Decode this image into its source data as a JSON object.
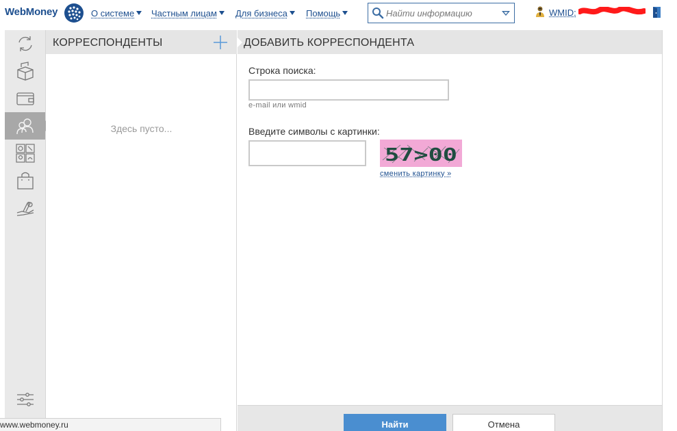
{
  "header": {
    "logo_text": "WebMoney",
    "nav": [
      {
        "label": "О системе"
      },
      {
        "label": "Частным лицам"
      },
      {
        "label": "Для бизнеса"
      },
      {
        "label": "Помощь"
      }
    ],
    "search_placeholder": "Найти информацию",
    "wmid_label": "WMID:"
  },
  "rail": {
    "items": [
      {
        "icon": "refresh-icon"
      },
      {
        "icon": "boxes-icon"
      },
      {
        "icon": "wallet-icon"
      },
      {
        "icon": "correspondents-icon",
        "active": true
      },
      {
        "icon": "services-icon"
      },
      {
        "icon": "shopping-bag-icon"
      },
      {
        "icon": "hand-coin-icon"
      }
    ],
    "settings_icon": "sliders-icon"
  },
  "correspondents": {
    "title": "КОРРЕСПОНДЕНТЫ",
    "empty_text": "Здесь пусто..."
  },
  "add_correspondent": {
    "title": "ДОБАВИТЬ КОРРЕСПОНДЕНТА",
    "search_label": "Строка поиска:",
    "search_value": "",
    "search_hint": "e-mail или wmid",
    "captcha_label": "Введите символы с картинки:",
    "captcha_value": "",
    "captcha_image_text": "57>00",
    "change_captcha_link": "сменить картинку »",
    "find_button": "Найти",
    "cancel_button": "Отмена"
  },
  "status_bar": {
    "url": "www.webmoney.ru"
  },
  "colors": {
    "brand": "#1d4f8f",
    "primary_button": "#4a8ed0",
    "active_rail": "#a8a8a8",
    "captcha_bg": "#f2a9d6"
  }
}
